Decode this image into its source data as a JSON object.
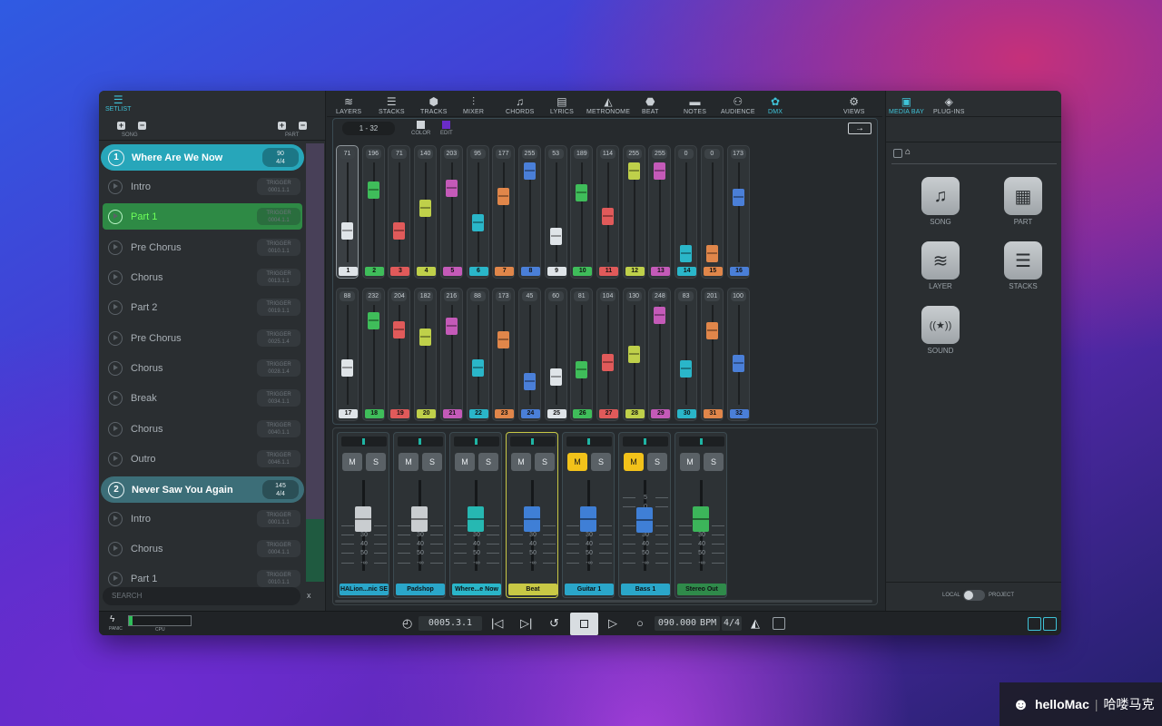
{
  "setlist": {
    "tab_label": "SETLIST",
    "song_label": "SONG",
    "part_label": "PART",
    "search_placeholder": "SEARCH",
    "search_clear": "x",
    "songs": [
      {
        "num": "1",
        "title": "Where Are We Now",
        "badge_top": "90",
        "badge_bottom": "4/4",
        "color": "#27a6ba",
        "parts": [
          {
            "name": "Intro",
            "trig": "TRIGGER",
            "pos": "0001.1.1"
          },
          {
            "name": "Part 1",
            "trig": "TRIGGER",
            "pos": "0004.1.1",
            "active": true
          },
          {
            "name": "Pre Chorus",
            "trig": "TRIGGER",
            "pos": "0010.1.1"
          },
          {
            "name": "Chorus",
            "trig": "TRIGGER",
            "pos": "0013.1.1"
          },
          {
            "name": "Part 2",
            "trig": "TRIGGER",
            "pos": "0019.1.1"
          },
          {
            "name": "Pre Chorus",
            "trig": "TRIGGER",
            "pos": "0025.1.4"
          },
          {
            "name": "Chorus",
            "trig": "TRIGGER",
            "pos": "0028.1.4"
          },
          {
            "name": "Break",
            "trig": "TRIGGER",
            "pos": "0034.1.1"
          },
          {
            "name": "Chorus",
            "trig": "TRIGGER",
            "pos": "0040.1.1"
          },
          {
            "name": "Outro",
            "trig": "TRIGGER",
            "pos": "0046.1.1"
          }
        ]
      },
      {
        "num": "2",
        "title": "Never Saw You Again",
        "badge_top": "145",
        "badge_bottom": "4/4",
        "color": "#3c6e78",
        "parts": [
          {
            "name": "Intro",
            "trig": "TRIGGER",
            "pos": "0001.1.1"
          },
          {
            "name": "Chorus",
            "trig": "TRIGGER",
            "pos": "0004.1.1"
          },
          {
            "name": "Part 1",
            "trig": "TRIGGER",
            "pos": "0010.1.1"
          }
        ]
      }
    ]
  },
  "toolbar": [
    {
      "label": "LAYERS",
      "icon": "layers-icon",
      "glyph": "≋"
    },
    {
      "label": "STACKS",
      "icon": "stacks-icon",
      "glyph": "☰"
    },
    {
      "label": "TRACKS",
      "icon": "tracks-icon",
      "glyph": "⬢"
    },
    {
      "label": "MIXER",
      "icon": "mixer-icon",
      "glyph": "⫶"
    },
    {
      "label": "CHORDS",
      "icon": "chords-icon",
      "glyph": "♫"
    },
    {
      "label": "LYRICS",
      "icon": "lyrics-icon",
      "glyph": "▤"
    },
    {
      "label": "METRONOME",
      "icon": "metronome-icon",
      "glyph": "◭"
    },
    {
      "label": "BEAT",
      "icon": "beat-icon",
      "glyph": "⬣"
    },
    {
      "label": "NOTES",
      "icon": "notes-icon",
      "glyph": "▬"
    },
    {
      "label": "AUDIENCE",
      "icon": "audience-icon",
      "glyph": "⚇"
    },
    {
      "label": "DMX",
      "icon": "dmx-icon",
      "glyph": "✿",
      "active": true
    },
    {
      "label": "VIEWS",
      "icon": "gear-icon",
      "glyph": "⚙"
    }
  ],
  "dmx": {
    "range": "1 - 32",
    "color_label": "COLOR",
    "edit_label": "EDIT",
    "arrow": "→",
    "channels": [
      {
        "n": "1",
        "v": 71,
        "c": "#dfe4e8"
      },
      {
        "n": "2",
        "v": 196,
        "c": "#3fbd5a"
      },
      {
        "n": "3",
        "v": 71,
        "c": "#e05a5a"
      },
      {
        "n": "4",
        "v": 140,
        "c": "#bfd04a"
      },
      {
        "n": "5",
        "v": 203,
        "c": "#c45ab8"
      },
      {
        "n": "6",
        "v": 95,
        "c": "#2ab6c9"
      },
      {
        "n": "7",
        "v": 177,
        "c": "#e0864a"
      },
      {
        "n": "8",
        "v": 255,
        "c": "#4a7fd8"
      },
      {
        "n": "9",
        "v": 53,
        "c": "#dfe4e8"
      },
      {
        "n": "10",
        "v": 189,
        "c": "#3fbd5a"
      },
      {
        "n": "11",
        "v": 114,
        "c": "#e05a5a"
      },
      {
        "n": "12",
        "v": 255,
        "c": "#bfd04a"
      },
      {
        "n": "13",
        "v": 255,
        "c": "#c45ab8"
      },
      {
        "n": "14",
        "v": 0,
        "c": "#2ab6c9"
      },
      {
        "n": "15",
        "v": 0,
        "c": "#e0864a"
      },
      {
        "n": "16",
        "v": 173,
        "c": "#4a7fd8"
      },
      {
        "n": "17",
        "v": 88,
        "c": "#dfe4e8"
      },
      {
        "n": "18",
        "v": 232,
        "c": "#3fbd5a"
      },
      {
        "n": "19",
        "v": 204,
        "c": "#e05a5a"
      },
      {
        "n": "20",
        "v": 182,
        "c": "#bfd04a"
      },
      {
        "n": "21",
        "v": 216,
        "c": "#c45ab8"
      },
      {
        "n": "22",
        "v": 88,
        "c": "#2ab6c9"
      },
      {
        "n": "23",
        "v": 173,
        "c": "#e0864a"
      },
      {
        "n": "24",
        "v": 45,
        "c": "#4a7fd8"
      },
      {
        "n": "25",
        "v": 60,
        "c": "#dfe4e8"
      },
      {
        "n": "26",
        "v": 81,
        "c": "#3fbd5a"
      },
      {
        "n": "27",
        "v": 104,
        "c": "#e05a5a"
      },
      {
        "n": "28",
        "v": 130,
        "c": "#bfd04a"
      },
      {
        "n": "29",
        "v": 248,
        "c": "#c45ab8"
      },
      {
        "n": "30",
        "v": 83,
        "c": "#2ab6c9"
      },
      {
        "n": "31",
        "v": 201,
        "c": "#e0864a"
      },
      {
        "n": "32",
        "v": 100,
        "c": "#4a7fd8"
      }
    ]
  },
  "mixer": {
    "mute_label": "M",
    "solo_label": "S",
    "scale": [
      "20",
      "30",
      "40",
      "50",
      "-∞"
    ],
    "bass_scale": [
      "5",
      "0",
      "20",
      "30",
      "40",
      "50",
      "-∞"
    ],
    "strips": [
      {
        "name": "HALion...nic SE",
        "color": "#2aa6c9",
        "knob": "#c9cdd0",
        "level": 0.52,
        "m": false,
        "sel": false
      },
      {
        "name": "Padshop",
        "color": "#2aa6c9",
        "knob": "#c9cdd0",
        "level": 0.52,
        "m": false,
        "sel": false
      },
      {
        "name": "Where...e Now",
        "color": "#2ab6c9",
        "knob": "#26b8b2",
        "level": 0.52,
        "m": false,
        "sel": false
      },
      {
        "name": "Beat",
        "color": "#c8c845",
        "knob": "#3f7fd6",
        "level": 0.52,
        "m": false,
        "sel": true
      },
      {
        "name": "Guitar 1",
        "color": "#2aa6c9",
        "knob": "#3f7fd6",
        "level": 0.52,
        "m": true,
        "sel": false
      },
      {
        "name": "Bass 1",
        "color": "#2aa6c9",
        "knob": "#3f7fd6",
        "level": 0.32,
        "m": true,
        "sel": false
      },
      {
        "name": "Stereo Out",
        "color": "#2f8a4a",
        "knob": "#3cb55a",
        "level": 0.52,
        "m": false,
        "sel": false
      }
    ]
  },
  "right": {
    "tab1": "MEDIA BAY",
    "tab2": "PLUG-INS",
    "tiles": [
      {
        "label": "SONG",
        "icon": "song-icon",
        "glyph": "♫"
      },
      {
        "label": "PART",
        "icon": "part-icon",
        "glyph": "▦"
      },
      {
        "label": "LAYER",
        "icon": "layer-icon",
        "glyph": "≋"
      },
      {
        "label": "STACKS",
        "icon": "stacks-icon",
        "glyph": "☰"
      },
      {
        "label": "SOUND",
        "icon": "sound-icon",
        "glyph": "((★))"
      }
    ],
    "local": "LOCAL",
    "project": "PROJECT"
  },
  "transport": {
    "panic": "PANIC",
    "cpu": "CPU",
    "position": "0005.3.1",
    "tempo": "090.000",
    "bpm": "BPM",
    "signature": "4/4"
  },
  "watermark": {
    "brand": "helloMac",
    "cn": "哈喽马克"
  }
}
